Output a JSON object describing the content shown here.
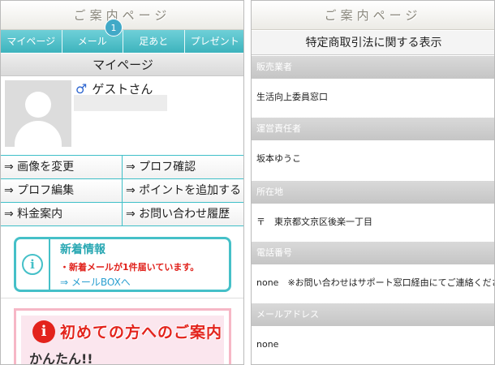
{
  "left": {
    "header_title": "ご案内ページ",
    "nav": [
      "マイページ",
      "メール",
      "足あと",
      "プレゼント"
    ],
    "mail_badge": "1",
    "section_title": "マイページ",
    "username": "ゲストさん",
    "menu": [
      "⇒ 画像を変更",
      "⇒ プロフ確認",
      "⇒ プロフ編集",
      "⇒ ポイントを追加する",
      "⇒ 料金案内",
      "⇒ お問い合わせ履歴"
    ],
    "info": {
      "title": "新着情報",
      "message": "・新着メールが1件届いています。",
      "link": "⇒ メールBOXへ"
    },
    "banner": {
      "title": "初めての方へのご案内",
      "subtitle": "かんたん!!"
    }
  },
  "right": {
    "header_title": "ご案内ページ",
    "page_title": "特定商取引法に関する表示",
    "rows": [
      {
        "label": "販売業者",
        "value": "生活向上委員窓口"
      },
      {
        "label": "運営責任者",
        "value": "坂本ゆうこ"
      },
      {
        "label": "所在地",
        "value": "〒　東京都文京区後楽一丁目"
      },
      {
        "label": "電話番号",
        "value": "none　※お問い合わせはサポート窓口経由にてご連絡ください"
      },
      {
        "label": "メールアドレス",
        "value": "none"
      }
    ]
  },
  "colors": {
    "accent": "#45c0c8",
    "alert": "#e0201a",
    "link": "#2a9fd0"
  }
}
